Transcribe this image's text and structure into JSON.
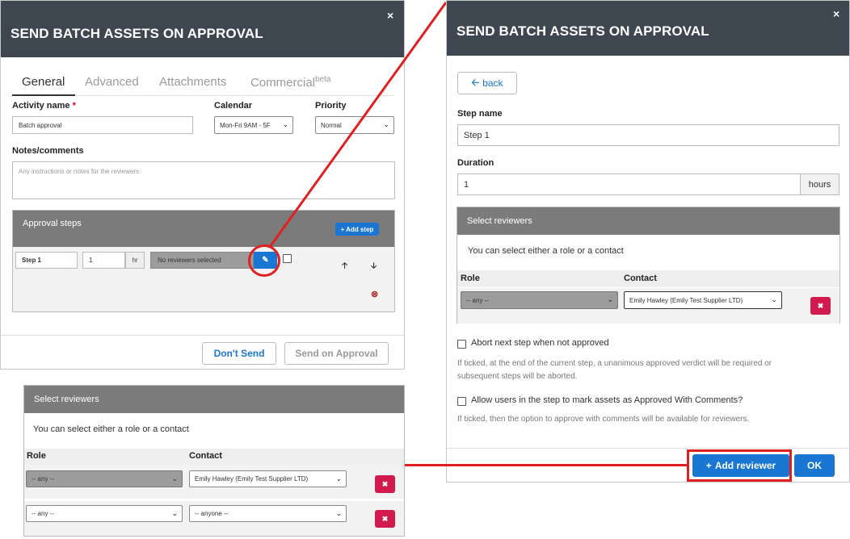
{
  "left_dialog": {
    "title": "SEND BATCH ASSETS ON APPROVAL",
    "close": "×",
    "tabs": [
      {
        "label": "General"
      },
      {
        "label": "Advanced"
      },
      {
        "label": "Attachments"
      },
      {
        "label": "Commercial",
        "sup": "beta"
      }
    ],
    "activity_name_label": "Activity name",
    "required_mark": "*",
    "activity_name_value": "Batch approval",
    "calendar_label": "Calendar",
    "calendar_value": "Mon-Fri 9AM - 5F",
    "priority_label": "Priority",
    "priority_value": "Normal",
    "notes_label": "Notes/comments",
    "notes_placeholder": "Any instructions or notes for the reviewers",
    "approval_steps_label": "Approval steps",
    "add_step_label": "+ Add step",
    "step": {
      "name": "Step 1",
      "duration": "1",
      "unit": "hr",
      "reviewers": "No reviewers selected"
    },
    "up_arrow": "🡡",
    "down_arrow": "🡣",
    "remove_icon": "⊗",
    "dont_send_label": "Don't Send",
    "send_on_approval_label": "Send on Approval"
  },
  "right_dialog": {
    "title": "SEND BATCH ASSETS ON APPROVAL",
    "close": "×",
    "back_label": "back",
    "step_name_label": "Step name",
    "step_name_value": "Step 1",
    "duration_label": "Duration",
    "duration_value": "1",
    "duration_unit": "hours",
    "select_reviewers_header": "Select reviewers",
    "select_hint": "You can select either a role or a contact",
    "role_header": "Role",
    "contact_header": "Contact",
    "role_value": "-- any --",
    "contact_value": "Emily Hawley (Emily Test Supplier LTD)",
    "abort_label": "Abort next step when not approved",
    "abort_help": "If ticked, at the end of the current step, a unanimous approved verdict will be required or subsequent steps will be aborted.",
    "allow_label": "Allow users in the step to mark assets as Approved With Comments?",
    "allow_help": "If ticked, then the option to approve with comments will be available for reviewers.",
    "add_reviewer_label": "Add reviewer",
    "ok_label": "OK"
  },
  "bottom_panel": {
    "header": "Select reviewers",
    "hint": "You can select either a role or a contact",
    "role_header": "Role",
    "contact_header": "Contact",
    "rows": [
      {
        "role": "-- any --",
        "contact": "Emily Hawley (Emily Test Supplier LTD)"
      },
      {
        "role": "-- any --",
        "contact": "-- anyone --"
      }
    ]
  },
  "colors": {
    "header_bg": "#3e4750",
    "primary_blue": "#1976d2",
    "delete_red": "#d11a4d",
    "highlight_red": "#e02020"
  }
}
